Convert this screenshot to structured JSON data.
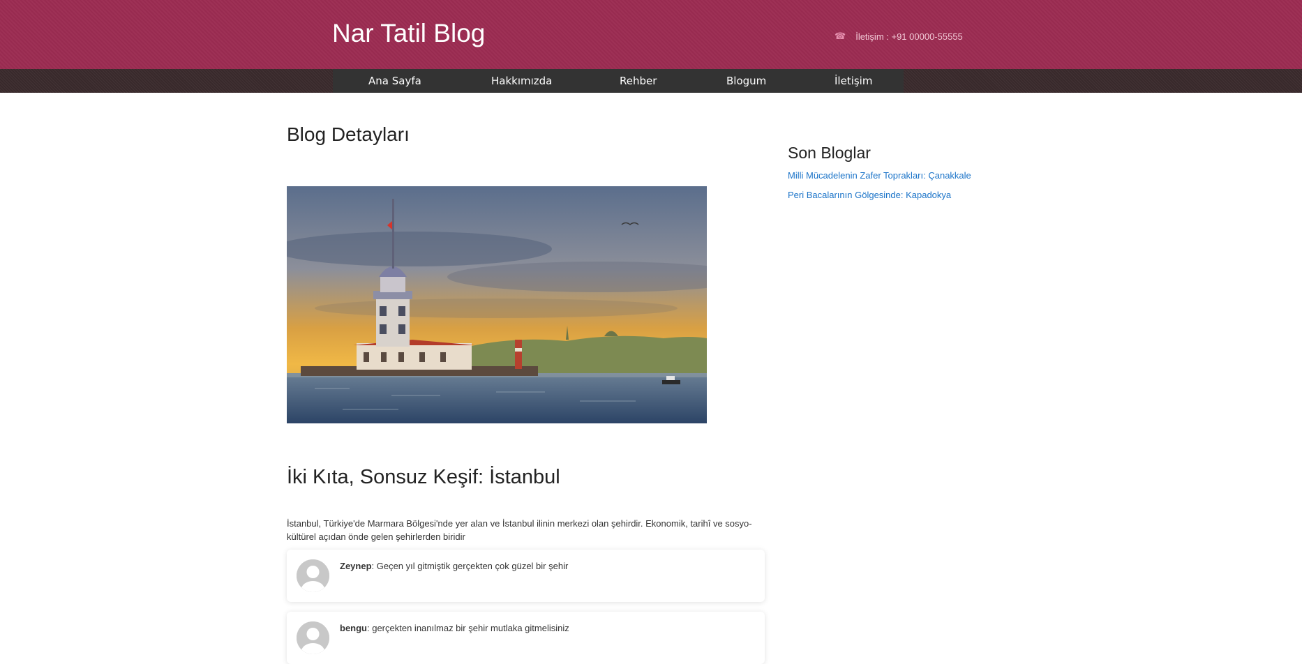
{
  "header": {
    "site_title": "Nar Tatil Blog",
    "contact_text": "İletişim : +91 00000-55555",
    "contact_icon": "phone-icon",
    "background_color": "#9c2c52"
  },
  "nav": {
    "items": [
      {
        "label": "Ana Sayfa"
      },
      {
        "label": "Hakkımızda"
      },
      {
        "label": "Rehber"
      },
      {
        "label": "Blogum"
      },
      {
        "label": "İletişim"
      }
    ]
  },
  "main": {
    "page_title": "Blog Detayları",
    "post_title": "İki Kıta, Sonsuz Keşif: İstanbul",
    "post_body": "İstanbul, Türkiye'de Marmara Bölgesi'nde yer alan ve İstanbul ilinin merkezi olan şehirdir. Ekonomik, tarihî ve sosyo-kültürel açıdan önde gelen şehirlerden biridir"
  },
  "comments": [
    {
      "author": "Zeynep",
      "text": ": Geçen yıl gitmiştik gerçekten çok güzel bir şehir"
    },
    {
      "author": "bengu",
      "text": ": gerçekten inanılmaz bir şehir mutlaka gitmelisiniz"
    }
  ],
  "sidebar": {
    "title": "Son Bloglar",
    "links": [
      {
        "label": "Milli Mücadelenin Zafer Toprakları: Çanakkale"
      },
      {
        "label": "Peri Bacalarının Gölgesinde: Kapadokya"
      }
    ]
  }
}
